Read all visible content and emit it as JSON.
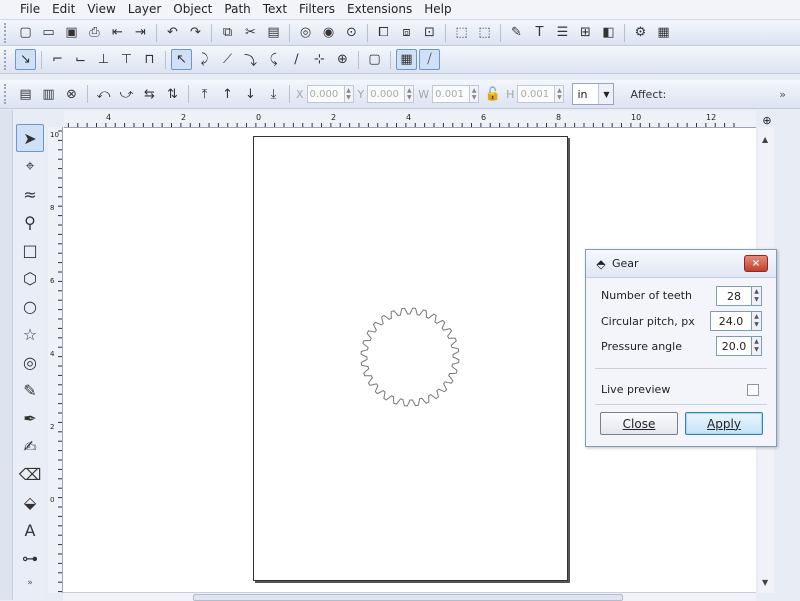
{
  "menu": [
    "File",
    "Edit",
    "View",
    "Layer",
    "Object",
    "Path",
    "Text",
    "Filters",
    "Extensions",
    "Help"
  ],
  "toolbar_commands": [
    [
      "new-doc-icon",
      "▢"
    ],
    [
      "open-icon",
      "▭"
    ],
    [
      "save-icon",
      "▣"
    ],
    [
      "print-icon",
      "⎙"
    ],
    [
      "import-icon",
      "⇤"
    ],
    [
      "export-icon",
      "⇥"
    ],
    [
      "undo-icon",
      "↶"
    ],
    [
      "redo-icon",
      "↷"
    ],
    [
      "copy-icon",
      "⧉"
    ],
    [
      "cut-icon",
      "✂"
    ],
    [
      "paste-icon",
      "▤"
    ],
    [
      "zoom-selection-icon",
      "◎"
    ],
    [
      "zoom-drawing-icon",
      "◉"
    ],
    [
      "zoom-page-icon",
      "⊙"
    ],
    [
      "duplicate-icon",
      "⧠"
    ],
    [
      "clone-icon",
      "⧈"
    ],
    [
      "unlink-clone-icon",
      "⊡"
    ],
    [
      "group-icon",
      "⬚"
    ],
    [
      "ungroup-icon",
      "⬚"
    ],
    [
      "xml-editor-icon",
      "✎"
    ],
    [
      "text-font-icon",
      "T"
    ],
    [
      "layers-icon",
      "☰"
    ],
    [
      "align-icon",
      "⊞"
    ],
    [
      "fill-stroke-icon",
      "◧"
    ],
    [
      "preferences-icon",
      "⚙"
    ],
    [
      "document-properties-icon",
      "▦"
    ]
  ],
  "snap_bar_icons": [
    [
      "snap-enable-icon",
      "↘",
      true
    ],
    [
      "snap-bbox-icon",
      "⌐",
      false
    ],
    [
      "snap-bbox-edge-icon",
      "⌙",
      false
    ],
    [
      "snap-bbox-corner-icon",
      "⊥",
      false
    ],
    [
      "snap-bbox-midpoint-icon",
      "⊤",
      false
    ],
    [
      "snap-bbox-center-icon",
      "⊓",
      false
    ],
    [
      "snap-nodes-icon",
      "↖",
      true
    ],
    [
      "snap-path-icon",
      "⤸",
      false
    ],
    [
      "snap-path-intersect-icon",
      "⟋",
      false
    ],
    [
      "snap-cusp-node-icon",
      "⤵",
      false
    ],
    [
      "snap-smooth-node-icon",
      "⤹",
      false
    ],
    [
      "snap-midpoint-icon",
      "∕",
      false
    ],
    [
      "snap-object-center-icon",
      "⊹",
      false
    ],
    [
      "snap-rotation-center-icon",
      "⊕",
      false
    ],
    [
      "snap-page-border-icon",
      "▢",
      false
    ],
    [
      "snap-grid-icon",
      "▦",
      true
    ],
    [
      "snap-guide-icon",
      "⧸",
      true
    ]
  ],
  "select_bar_icons": [
    [
      "select-all-icon",
      "▤"
    ],
    [
      "select-all-layers-icon",
      "▥"
    ],
    [
      "deselect-icon",
      "⊗"
    ],
    [
      "rotate-ccw-icon",
      "⤺"
    ],
    [
      "rotate-cw-icon",
      "⤻"
    ],
    [
      "flip-horizontal-icon",
      "⇆"
    ],
    [
      "flip-vertical-icon",
      "⇅"
    ],
    [
      "raise-top-icon",
      "⤒"
    ],
    [
      "raise-icon",
      "↑"
    ],
    [
      "lower-icon",
      "↓"
    ],
    [
      "lower-bottom-icon",
      "⤓"
    ]
  ],
  "coords": [
    {
      "label": "X",
      "value": "0.000"
    },
    {
      "label": "Y",
      "value": "0.000"
    },
    {
      "label": "W",
      "value": "0.001"
    },
    {
      "label": "H",
      "value": "0.001"
    }
  ],
  "lock_icon": "lock-icon",
  "unit": "in",
  "affect_label": "Affect:",
  "more_label": "»",
  "tools": [
    [
      "selector-tool",
      "➤",
      true
    ],
    [
      "node-tool",
      "⌖",
      false
    ],
    [
      "tweak-tool",
      "≈",
      false
    ],
    [
      "zoom-tool",
      "⚲",
      false
    ],
    [
      "rectangle-tool",
      "□",
      false
    ],
    [
      "3d-box-tool",
      "⬡",
      false
    ],
    [
      "ellipse-tool",
      "○",
      false
    ],
    [
      "star-tool",
      "☆",
      false
    ],
    [
      "spiral-tool",
      "◎",
      false
    ],
    [
      "pencil-tool",
      "✎",
      false
    ],
    [
      "pen-tool",
      "✒",
      false
    ],
    [
      "calligraphy-tool",
      "✍",
      false
    ],
    [
      "eraser-tool",
      "⌫",
      false
    ],
    [
      "paint-bucket-tool",
      "⬙",
      false
    ],
    [
      "text-tool",
      "A",
      false
    ],
    [
      "connector-tool",
      "⊶",
      false
    ]
  ],
  "toolbox_more": "»",
  "hruler_labels": [
    {
      "v": -4,
      "t": "4"
    },
    {
      "v": -2,
      "t": "2"
    },
    {
      "v": 0,
      "t": "0"
    },
    {
      "v": 2,
      "t": "2"
    },
    {
      "v": 4,
      "t": "4"
    },
    {
      "v": 6,
      "t": "6"
    },
    {
      "v": 8,
      "t": "8"
    },
    {
      "v": 10,
      "t": "10"
    },
    {
      "v": 12,
      "t": "12"
    }
  ],
  "vruler_labels": [
    "10",
    "8",
    "6",
    "4",
    "2",
    "0"
  ],
  "zoom_icon": "zoom-fit-icon",
  "gear_dialog": {
    "title": "Gear",
    "close_label": "×",
    "teeth_label": "Number of teeth",
    "teeth_value": "28",
    "pitch_label": "Circular pitch, px",
    "pitch_value": "24.0",
    "angle_label": "Pressure angle",
    "angle_value": "20.0",
    "live_preview_label": "Live preview",
    "live_preview_checked": false,
    "close_button": "Close",
    "apply_button": "Apply"
  },
  "gear": {
    "teeth": 28
  }
}
